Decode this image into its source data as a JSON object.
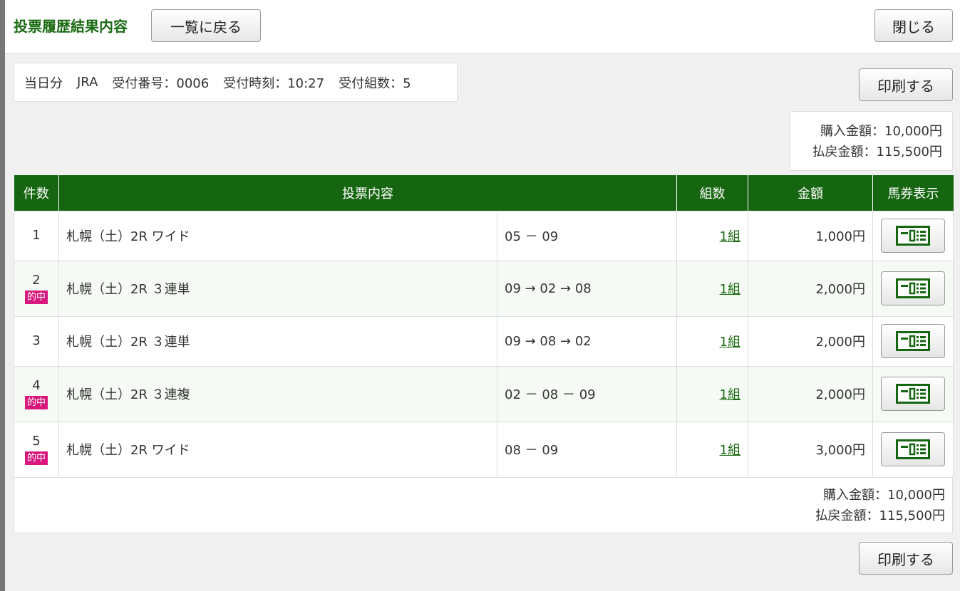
{
  "header": {
    "title": "投票履歴結果内容",
    "back_label": "一覧に戻る",
    "close_label": "閉じる"
  },
  "info": {
    "day": "当日分",
    "org": "JRA",
    "receipt_no": "受付番号：0006",
    "receipt_time": "受付時刻：10:27",
    "receipt_sets": "受付組数：5"
  },
  "print_label": "印刷する",
  "totals": {
    "purchase": "購入金額：10,000円",
    "payout": "払戻金額：115,500円"
  },
  "table": {
    "headers": [
      "件数",
      "投票内容",
      "組数",
      "金額",
      "馬券表示"
    ],
    "rows": [
      {
        "no": "1",
        "hit": "",
        "race": "札幌（土）2R ワイド",
        "combo": "05 － 09",
        "sets": "1組",
        "amount": "1,000円"
      },
      {
        "no": "2",
        "hit": "的中",
        "race": "札幌（土）2R ３連単",
        "combo": "09 → 02 → 08",
        "sets": "1組",
        "amount": "2,000円"
      },
      {
        "no": "3",
        "hit": "",
        "race": "札幌（土）2R ３連単",
        "combo": "09 → 08 → 02",
        "sets": "1組",
        "amount": "2,000円"
      },
      {
        "no": "4",
        "hit": "的中",
        "race": "札幌（土）2R ３連複",
        "combo": "02 － 08 － 09",
        "sets": "1組",
        "amount": "2,000円"
      },
      {
        "no": "5",
        "hit": "的中",
        "race": "札幌（土）2R ワイド",
        "combo": "08 － 09",
        "sets": "1組",
        "amount": "3,000円"
      }
    ]
  },
  "colors": {
    "brand_green": "#166611",
    "hit_badge": "#d8187c"
  }
}
